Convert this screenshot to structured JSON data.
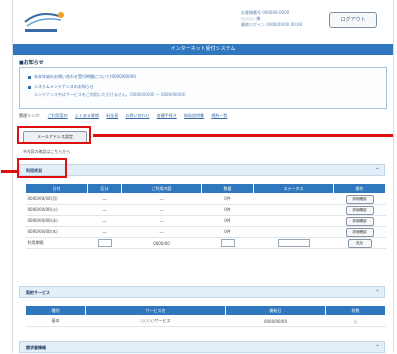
{
  "colors": {
    "brand": "#2f78bf",
    "highlight": "#dd1111",
    "section_bg": "#e4eef8"
  },
  "header": {
    "info_line1": "お客様番号 000000-0000",
    "info_line2": "○○○○ 様",
    "info_line3": "最終ログイン 0000/00/00 00:00",
    "logout_label": "ログアウト",
    "system_title": "インターネット受付システム"
  },
  "notice": {
    "title": "■お知らせ",
    "items": [
      {
        "text": "年末年始のお問い合わせ受付時間について(0000/00/00)"
      },
      {
        "text": "システムメンテナンスのお知らせ"
      }
    ],
    "sub": "メンテナンス中はサービスをご利用いただけません。(0000/00/00 ～ 0000/00/00)"
  },
  "links": {
    "label": "関連リンク:",
    "items": [
      "ご利用案内",
      "よくある質問",
      "料金表",
      "お問い合わせ",
      "各種手続き",
      "取扱説明書",
      "規約一覧"
    ]
  },
  "settings": {
    "button_label": "メールアドレス設定",
    "note": "※内容の確認はこちらから"
  },
  "section1": {
    "title": "利用状況",
    "columns": [
      "日付",
      "区分",
      "ご利用内容",
      "数量",
      "ステータス",
      "操作"
    ],
    "rows": [
      {
        "date": "0000/00/00(月)",
        "type": "―",
        "content": "―",
        "qty": "0件",
        "status": "",
        "btn": "詳細確認"
      },
      {
        "date": "0000/00/00(火)",
        "type": "―",
        "content": "―",
        "qty": "0件",
        "status": "",
        "btn": "詳細確認"
      },
      {
        "date": "0000/00/00(水)",
        "type": "―",
        "content": "―",
        "qty": "0件",
        "status": "",
        "btn": "詳細確認"
      },
      {
        "date": "0000/00/00(木)",
        "type": "―",
        "content": "―",
        "qty": "0件",
        "status": "",
        "btn": "詳細確認"
      }
    ],
    "footer": {
      "label": "利用期間",
      "from": "0000/00",
      "to": "0000/00",
      "add_label": "追加"
    }
  },
  "section2": {
    "title": "契約サービス",
    "columns": [
      "種別",
      "サービス名",
      "開始日",
      "状態"
    ],
    "rows": [
      {
        "kind": "基本",
        "name": "○○○○サービス",
        "start": "0000/00/00",
        "state": "○"
      }
    ]
  },
  "section3": {
    "title": "請求書情報"
  }
}
